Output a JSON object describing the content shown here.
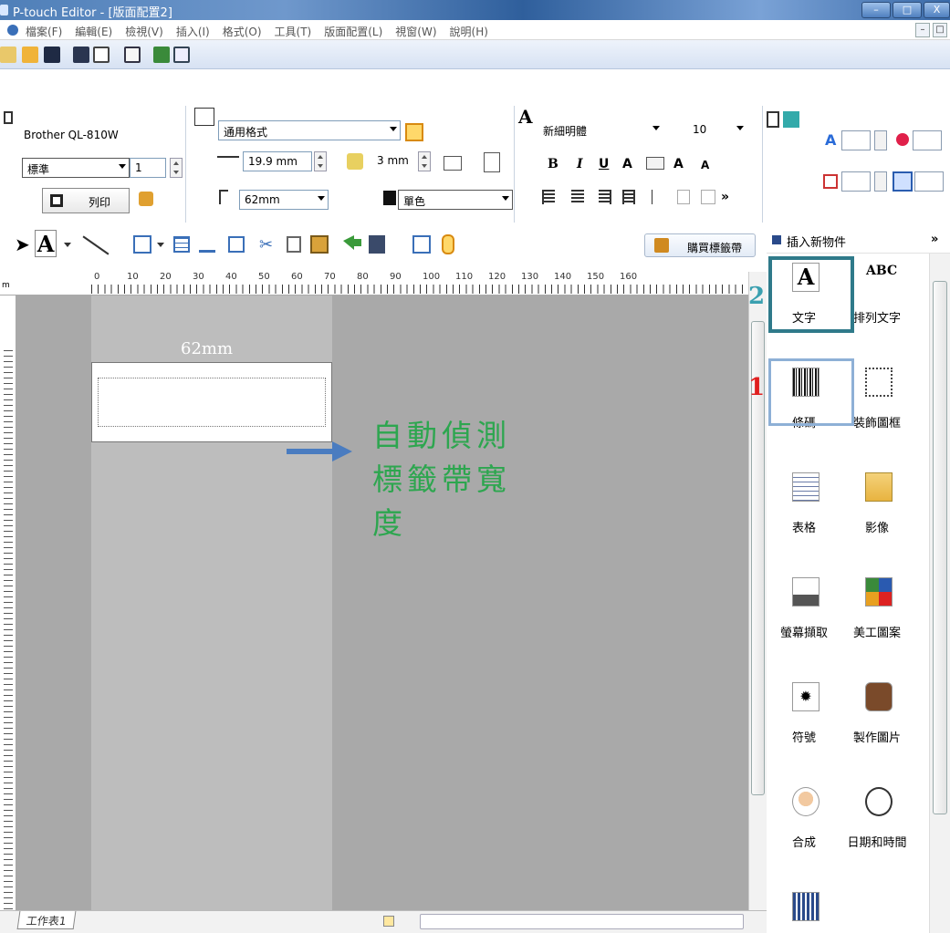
{
  "window": {
    "title": "P-touch Editor - [版面配置2]",
    "min": "–",
    "max": "□",
    "close": "X"
  },
  "menu": {
    "items": [
      "檔案(F)",
      "編輯(E)",
      "檢視(V)",
      "插入(I)",
      "格式(O)",
      "工具(T)",
      "版面配置(L)",
      "視窗(W)",
      "說明(H)"
    ]
  },
  "printer": {
    "name": "Brother QL-810W",
    "mode": "標準",
    "copies": "1",
    "print_label": "列印"
  },
  "paper": {
    "format": "通用格式",
    "length": "19.9 mm",
    "margin": "3 mm",
    "width": "62mm",
    "color": "單色"
  },
  "font": {
    "family": "新細明體",
    "size": "10"
  },
  "toolbar2": {
    "buy_label": "購買標籤帶"
  },
  "ruler": {
    "marks": [
      "0",
      "10",
      "20",
      "30",
      "40",
      "50",
      "60",
      "70",
      "80",
      "90",
      "100",
      "110",
      "120",
      "130",
      "140",
      "150",
      "160"
    ]
  },
  "canvas": {
    "tape_width": "62mm",
    "note": "自動偵測標籤帶寬度"
  },
  "sheet": {
    "tab": "工作表1"
  },
  "panel": {
    "title": "插入新物件",
    "more": "»",
    "items": [
      {
        "label": "文字",
        "icon": "text-icon"
      },
      {
        "label": "排列文字",
        "icon": "arrange-text-icon"
      },
      {
        "label": "條碼",
        "icon": "barcode-icon"
      },
      {
        "label": "裝飾圖框",
        "icon": "frame-icon"
      },
      {
        "label": "表格",
        "icon": "table-icon"
      },
      {
        "label": "影像",
        "icon": "image-icon"
      },
      {
        "label": "螢幕擷取",
        "icon": "screen-capture-icon"
      },
      {
        "label": "美工圖案",
        "icon": "clip-art-icon"
      },
      {
        "label": "符號",
        "icon": "symbol-icon"
      },
      {
        "label": "製作圖片",
        "icon": "make-picture-icon"
      },
      {
        "label": "合成",
        "icon": "composite-icon"
      },
      {
        "label": "日期和時間",
        "icon": "date-time-icon"
      }
    ]
  },
  "annotations": {
    "step1": "1",
    "step2": "2",
    "step1_color": "#e02020",
    "step2_color": "#3aa0b0"
  },
  "colors": {
    "note_green": "#2da64f",
    "highlight_teal": "#2f7a8a",
    "highlight_blue": "#8eb0d6",
    "arrow_blue": "#4a7cc0"
  }
}
